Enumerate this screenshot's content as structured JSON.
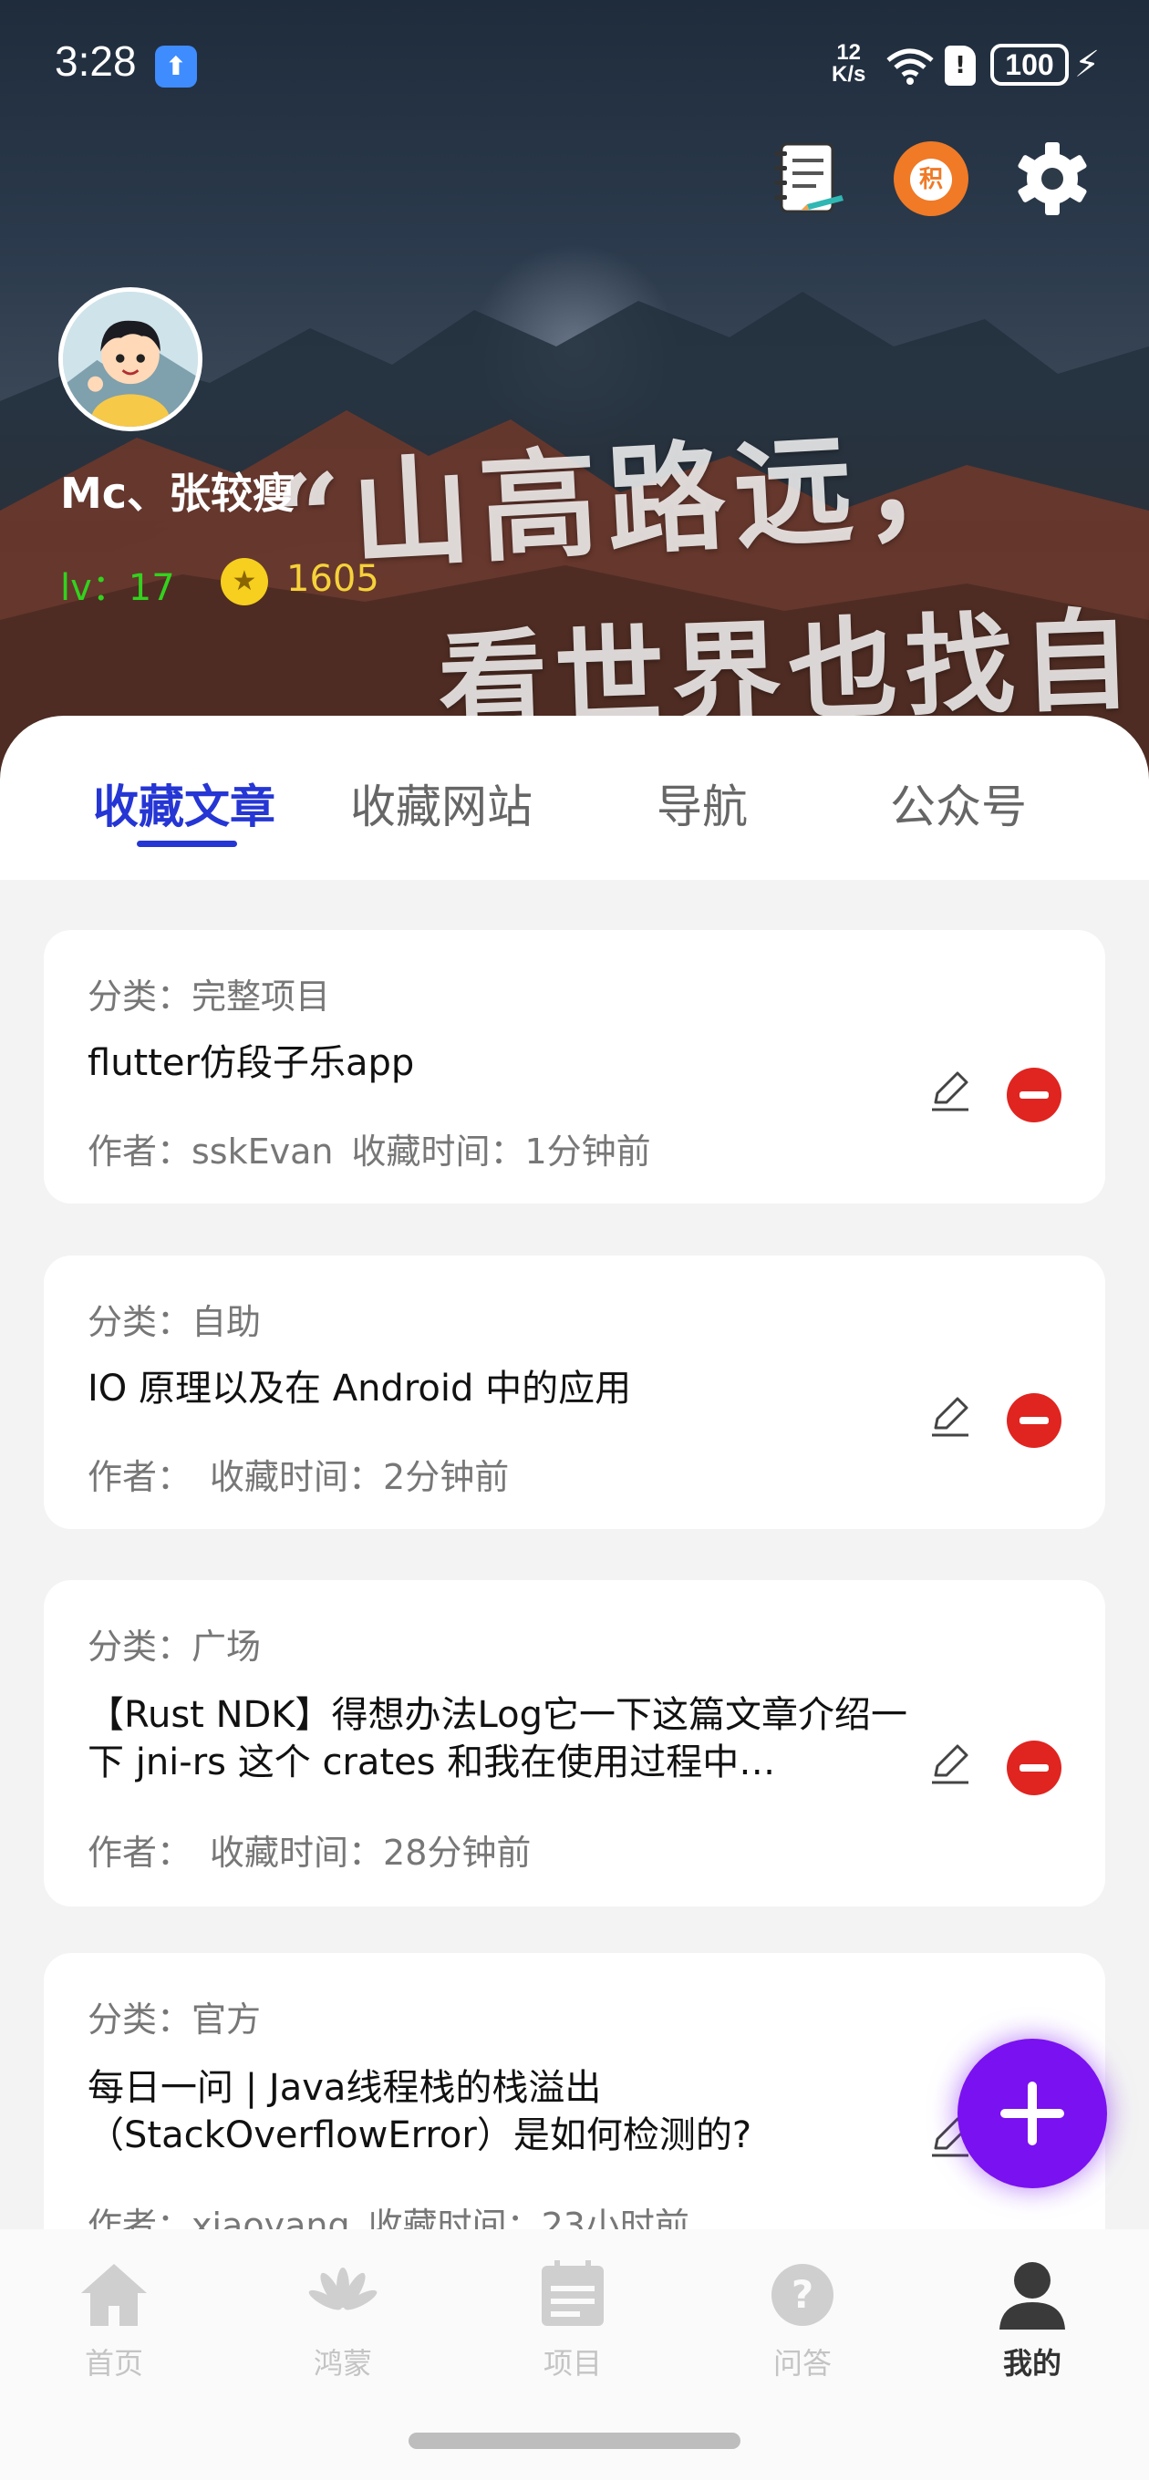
{
  "status_bar": {
    "time": "3:28",
    "net_speed_value": "12",
    "net_speed_unit": "K/s",
    "battery": "100"
  },
  "header": {
    "background_text_line1": "“山高路远，",
    "background_text_line2": "看世界也找自己。",
    "points_icon_char": "积"
  },
  "profile": {
    "username": "Mc、张较瘦",
    "level": "lv：17",
    "coins": "1605"
  },
  "tabs": [
    {
      "label": "收藏文章",
      "active": true
    },
    {
      "label": "收藏网站",
      "active": false
    },
    {
      "label": "导航",
      "active": false
    },
    {
      "label": "公众号",
      "active": false
    }
  ],
  "articles": [
    {
      "category": "分类：完整项目",
      "title": "flutter仿段子乐app",
      "author": "作者：sskEvan",
      "collected": "收藏时间：1分钟前"
    },
    {
      "category": "分类：自助",
      "title": "IO 原理以及在 Android 中的应用",
      "author": "作者：",
      "collected": "收藏时间：2分钟前"
    },
    {
      "category": "分类：广场",
      "title": "【Rust NDK】得想办法Log它一下这篇文章介绍一下 jni-rs 这个 crates 和我在使用过程中…",
      "author": "作者：",
      "collected": "收藏时间：28分钟前"
    },
    {
      "category": "分类：官方",
      "title": "每日一问 | Java线程栈的栈溢出（StackOverflowError）是如何检测的?",
      "author": "作者：xiaoyang",
      "collected": "收藏时间：23小时前"
    }
  ],
  "bottom_nav": [
    {
      "label": "首页",
      "icon": "home-icon",
      "active": false
    },
    {
      "label": "鸿蒙",
      "icon": "huawei-icon",
      "active": false
    },
    {
      "label": "项目",
      "icon": "project-icon",
      "active": false
    },
    {
      "label": "问答",
      "icon": "question-icon",
      "active": false
    },
    {
      "label": "我的",
      "icon": "profile-icon",
      "active": true
    }
  ],
  "colors": {
    "accent": "#2536d4",
    "fab": "#7a11f0",
    "delete": "#e02420",
    "level": "#33d21e",
    "coin": "#f6d23a"
  }
}
